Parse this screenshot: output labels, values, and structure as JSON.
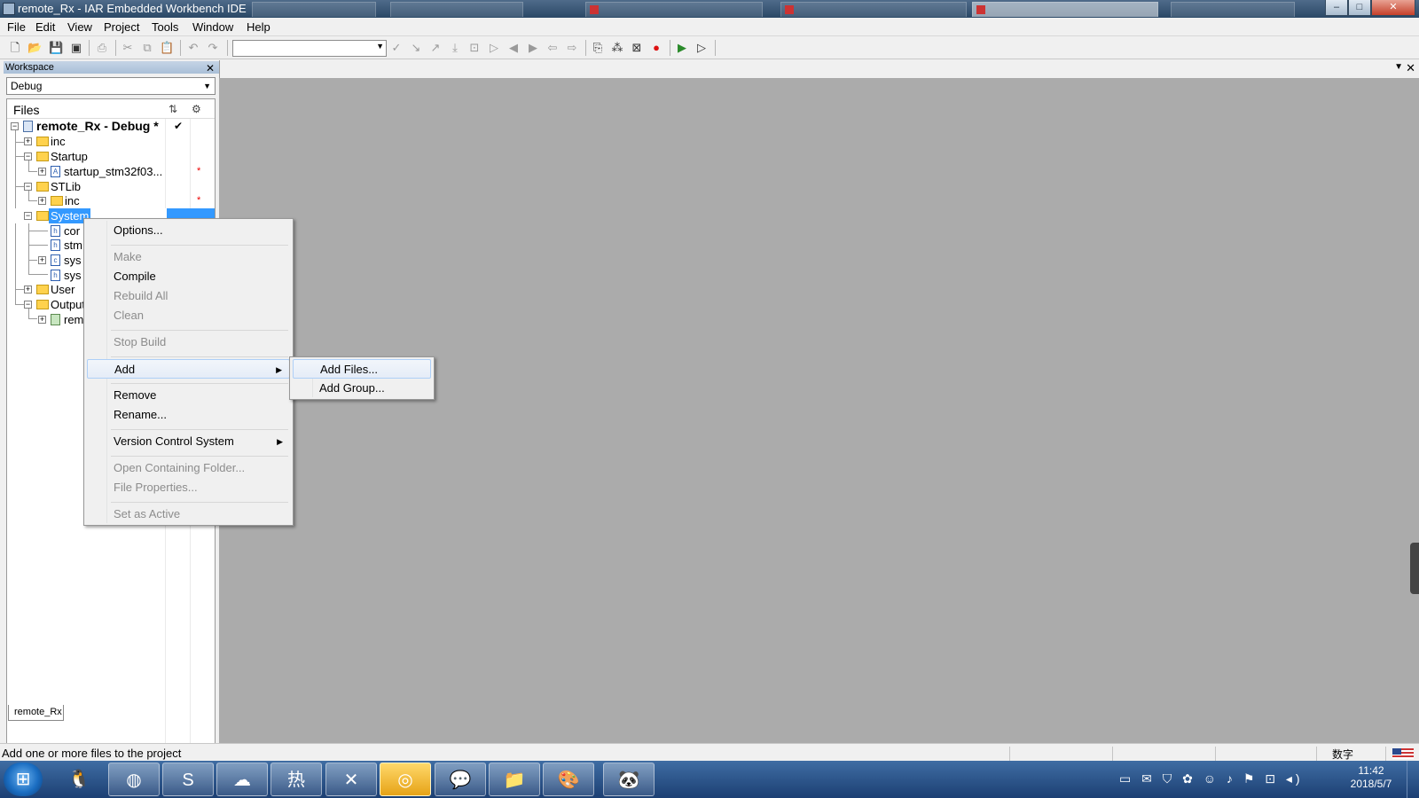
{
  "window": {
    "title": "remote_Rx - IAR Embedded Workbench IDE",
    "controls": {
      "minimize": "–",
      "maximize": "□",
      "close": "✕"
    }
  },
  "menubar": [
    "File",
    "Edit",
    "View",
    "Project",
    "Tools",
    "Window",
    "Help"
  ],
  "toolbar": {
    "combo_value": ""
  },
  "workspace": {
    "header": "Workspace",
    "config": "Debug",
    "files_label": "Files",
    "tab": "remote_Rx",
    "tree": [
      {
        "label": "remote_Rx - Debug *",
        "bold": true,
        "check": "✔",
        "dot": ""
      },
      {
        "label": "inc",
        "dot": ""
      },
      {
        "label": "Startup",
        "dot": ""
      },
      {
        "label": "startup_stm32f03...",
        "dot": "*"
      },
      {
        "label": "STLib",
        "dot": ""
      },
      {
        "label": "inc",
        "dot": "*"
      },
      {
        "label": "System",
        "dot": ""
      },
      {
        "label": "cor",
        "dot": ""
      },
      {
        "label": "stm",
        "dot": ""
      },
      {
        "label": "sys",
        "dot": ""
      },
      {
        "label": "sys",
        "dot": ""
      },
      {
        "label": "User",
        "dot": ""
      },
      {
        "label": "Output",
        "dot": ""
      },
      {
        "label": "rem",
        "dot": ""
      }
    ]
  },
  "context_menu": {
    "options": "Options...",
    "make": "Make",
    "compile": "Compile",
    "rebuild_all": "Rebuild All",
    "clean": "Clean",
    "stop_build": "Stop Build",
    "add": "Add",
    "remove": "Remove",
    "rename": "Rename...",
    "vcs": "Version Control System",
    "open_folder": "Open Containing Folder...",
    "file_properties": "File Properties...",
    "set_active": "Set as Active"
  },
  "submenu": {
    "add_files": "Add Files...",
    "add_group": "Add Group..."
  },
  "statusbar": {
    "message": "Add one or more files to the project",
    "mode": "数字"
  },
  "taskbar": {
    "clock_time": "11:42",
    "clock_date": "2018/5/7"
  },
  "colors": {
    "selection": "#3399ff",
    "editor_bg": "#ababab",
    "taskbar": "#1c3f73"
  }
}
